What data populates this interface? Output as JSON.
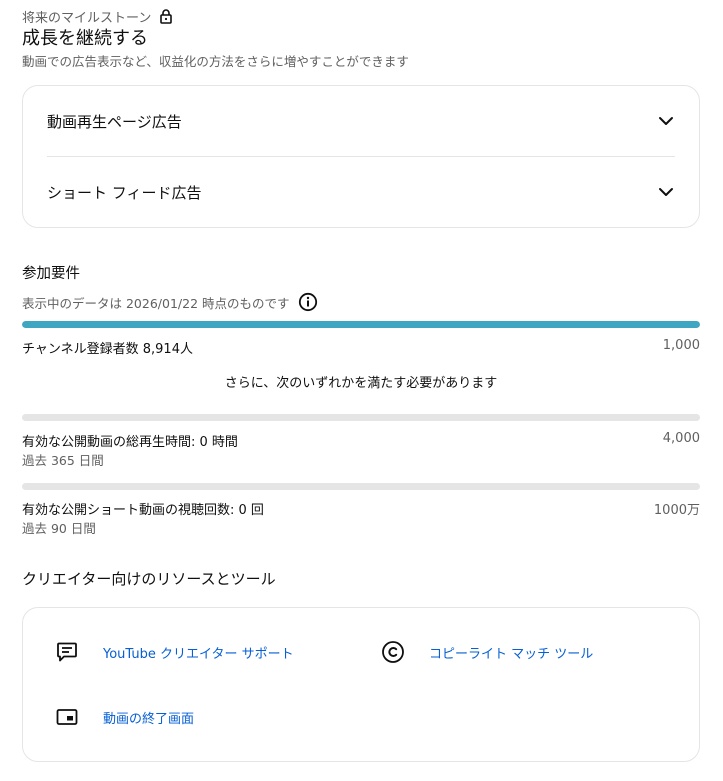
{
  "milestone": {
    "label": "将来のマイルストーン",
    "icon": "lock-icon"
  },
  "heading": "成長を継続する",
  "subheading": "動画での広告表示など、収益化の方法をさらに増やすことができます",
  "ads": {
    "items": [
      {
        "label": "動画再生ページ広告",
        "icon": "chevron-down-icon"
      },
      {
        "label": "ショート フィード広告",
        "icon": "chevron-down-icon"
      }
    ]
  },
  "requirements": {
    "title": "参加要件",
    "date_note": "表示中のデータは 2026/01/22 時点のものです",
    "info_icon": "info-icon",
    "subscribers": {
      "label": "チャンネル登録者数 8,914人",
      "target": "1,000",
      "progress": 1.0,
      "color": "#3ea6c0"
    },
    "or_note": "さらに、次のいずれかを満たす必要があります",
    "watch_hours": {
      "label": "有効な公開動画の総再生時間: 0 時間",
      "target": "4,000",
      "period": "過去 365 日間",
      "progress": 0.0
    },
    "shorts_views": {
      "label": "有効な公開ショート動画の視聴回数: 0 回",
      "target": "1000万",
      "period": "過去 90 日間",
      "progress": 0.0
    }
  },
  "resources": {
    "title": "クリエイター向けのリソースとツール",
    "links": [
      {
        "label": "YouTube クリエイター サポート",
        "icon": "support-chat-icon"
      },
      {
        "label": "コピーライト マッチ ツール",
        "icon": "copyright-icon"
      },
      {
        "label": "動画の終了画面",
        "icon": "end-screen-icon"
      }
    ]
  },
  "colors": {
    "link": "#065fd4",
    "progress_fill": "#3ea6c0",
    "progress_track": "#e5e5e5"
  }
}
